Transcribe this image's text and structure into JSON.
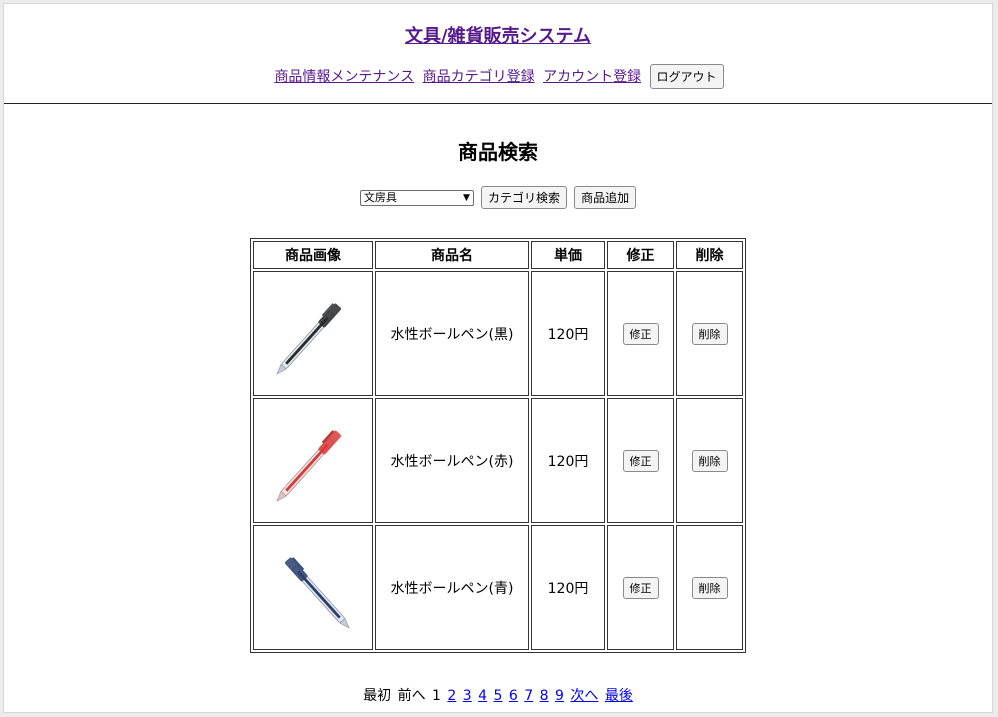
{
  "header": {
    "title": "文具/雑貨販売システム",
    "nav": [
      "商品情報メンテナンス",
      "商品カテゴリ登録",
      "アカウント登録"
    ],
    "logout_label": "ログアウト"
  },
  "main": {
    "title": "商品検索",
    "category_selected": "文房具",
    "category_search_label": "カテゴリ検索",
    "add_product_label": "商品追加"
  },
  "table": {
    "headers": [
      "商品画像",
      "商品名",
      "単価",
      "修正",
      "削除"
    ],
    "rows": [
      {
        "name": "水性ボールペン(黒)",
        "price": "120円",
        "edit": "修正",
        "delete": "削除",
        "pen_color": "#2a2a2a"
      },
      {
        "name": "水性ボールペン(赤)",
        "price": "120円",
        "edit": "修正",
        "delete": "削除",
        "pen_color": "#d83a3a"
      },
      {
        "name": "水性ボールペン(青)",
        "price": "120円",
        "edit": "修正",
        "delete": "削除",
        "pen_color": "#2b3f6e"
      }
    ]
  },
  "pager": {
    "first": "最初",
    "prev": "前へ",
    "current": "1",
    "pages": [
      "2",
      "3",
      "4",
      "5",
      "6",
      "7",
      "8",
      "9"
    ],
    "next": "次へ",
    "last": "最後"
  }
}
